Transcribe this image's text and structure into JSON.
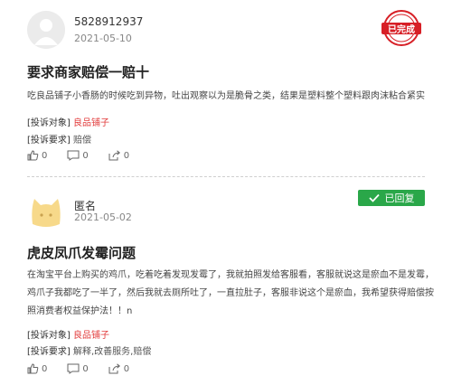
{
  "posts": [
    {
      "username": "5828912937",
      "date": "2021-05-10",
      "status_stamp": "已完成",
      "title": "要求商家赔偿一赔十",
      "body": "吃良品铺子小香肠的时候吃到异物，吐出观察以为是脆骨之类，结果是塑料整个塑料跟肉沫粘合紧实",
      "complaint_target_label": "[投诉对象]",
      "complaint_target_value": "良品铺子",
      "complaint_request_label": "[投诉要求]",
      "complaint_request_value": "赔偿",
      "likes": "0",
      "comments": "0",
      "shares": "0"
    },
    {
      "username": "匿名",
      "date": "2021-05-02",
      "status_badge": "已回复",
      "title": "虎皮凤爪发霉问题",
      "body_lines": [
        "在淘宝平台上购买的鸡爪，吃着吃着发现发霉了，我就拍照发给客服看，客服就说这是瘀血不是发霉，",
        "鸡爪子我都吃了一半了，然后我就去厕所吐了，一直拉肚子，客服非说这个是瘀血，我希望获得赔偿按",
        "照消费者权益保护法！！n"
      ],
      "complaint_target_label": "[投诉对象]",
      "complaint_target_value": "良品铺子",
      "complaint_request_label": "[投诉要求]",
      "complaint_request_value": "解释,改善服务,赔偿",
      "likes": "0",
      "comments": "0",
      "shares": "0"
    }
  ],
  "colors": {
    "accent_red": "#e23b3b",
    "badge_green": "#2aa749",
    "stamp_red": "#d71f26"
  }
}
